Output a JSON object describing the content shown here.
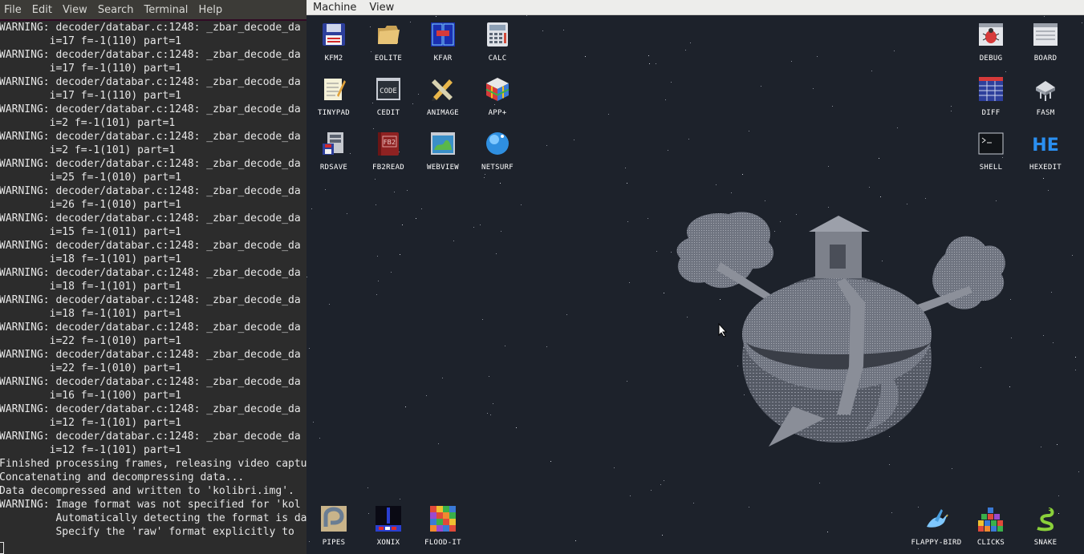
{
  "terminal": {
    "menu": [
      "File",
      "Edit",
      "View",
      "Search",
      "Terminal",
      "Help"
    ],
    "lines": [
      "WARNING: decoder/databar.c:1248: _zbar_decode_da",
      "        i=17 f=-1(110) part=1",
      "WARNING: decoder/databar.c:1248: _zbar_decode_da",
      "        i=17 f=-1(110) part=1",
      "WARNING: decoder/databar.c:1248: _zbar_decode_da",
      "        i=17 f=-1(110) part=1",
      "WARNING: decoder/databar.c:1248: _zbar_decode_da",
      "        i=2 f=-1(101) part=1",
      "WARNING: decoder/databar.c:1248: _zbar_decode_da",
      "        i=2 f=-1(101) part=1",
      "WARNING: decoder/databar.c:1248: _zbar_decode_da",
      "        i=25 f=-1(010) part=1",
      "WARNING: decoder/databar.c:1248: _zbar_decode_da",
      "        i=26 f=-1(010) part=1",
      "WARNING: decoder/databar.c:1248: _zbar_decode_da",
      "        i=15 f=-1(011) part=1",
      "WARNING: decoder/databar.c:1248: _zbar_decode_da",
      "        i=18 f=-1(101) part=1",
      "WARNING: decoder/databar.c:1248: _zbar_decode_da",
      "        i=18 f=-1(101) part=1",
      "WARNING: decoder/databar.c:1248: _zbar_decode_da",
      "        i=18 f=-1(101) part=1",
      "WARNING: decoder/databar.c:1248: _zbar_decode_da",
      "        i=22 f=-1(010) part=1",
      "WARNING: decoder/databar.c:1248: _zbar_decode_da",
      "        i=22 f=-1(010) part=1",
      "WARNING: decoder/databar.c:1248: _zbar_decode_da",
      "        i=16 f=-1(100) part=1",
      "WARNING: decoder/databar.c:1248: _zbar_decode_da",
      "        i=12 f=-1(101) part=1",
      "WARNING: decoder/databar.c:1248: _zbar_decode_da",
      "        i=12 f=-1(101) part=1",
      "Finished processing frames, releasing video captu",
      "Concatenating and decompressing data...",
      "Data decompressed and written to 'kolibri.img'.",
      "WARNING: Image format was not specified for 'kol",
      "         Automatically detecting the format is da",
      "         Specify the 'raw' format explicitly to"
    ]
  },
  "vm": {
    "menu": [
      "Machine",
      "View"
    ],
    "icons": [
      {
        "label": "KFM2",
        "icon": "floppy-disk-icon"
      },
      {
        "label": "EOLITE",
        "icon": "folder-icon"
      },
      {
        "label": "KFAR",
        "icon": "kfar-panels-icon"
      },
      {
        "label": "CALC",
        "icon": "calculator-icon"
      },
      {
        "label": "TINYPAD",
        "icon": "notepad-icon"
      },
      {
        "label": "CEDIT",
        "icon": "code-editor-icon"
      },
      {
        "label": "ANIMAGE",
        "icon": "pencil-brush-icon"
      },
      {
        "label": "APP+",
        "icon": "rubik-cube-icon"
      },
      {
        "label": "RDSAVE",
        "icon": "ramdisk-save-icon"
      },
      {
        "label": "FB2READ",
        "icon": "fb2-book-icon"
      },
      {
        "label": "WEBVIEW",
        "icon": "web-map-icon"
      },
      {
        "label": "NETSURF",
        "icon": "globe-icon"
      },
      {
        "label": "DEBUG",
        "icon": "bug-window-icon"
      },
      {
        "label": "BOARD",
        "icon": "board-window-icon"
      },
      {
        "label": "DIFF",
        "icon": "diff-grid-icon"
      },
      {
        "label": "FASM",
        "icon": "fasm-chip-icon"
      },
      {
        "label": "SHELL",
        "icon": "shell-terminal-icon"
      },
      {
        "label": "HEXEDIT",
        "icon": "hexedit-he-icon"
      },
      {
        "label": "PIPES",
        "icon": "pipes-game-icon"
      },
      {
        "label": "XONIX",
        "icon": "xonix-game-icon"
      },
      {
        "label": "FLOOD-IT",
        "icon": "flood-it-game-icon"
      },
      {
        "label": "FLAPPY-BIRD",
        "icon": "flappy-bird-icon"
      },
      {
        "label": "CLICKS",
        "icon": "clicks-blocks-icon"
      },
      {
        "label": "SNAKE",
        "icon": "snake-icon"
      }
    ]
  }
}
